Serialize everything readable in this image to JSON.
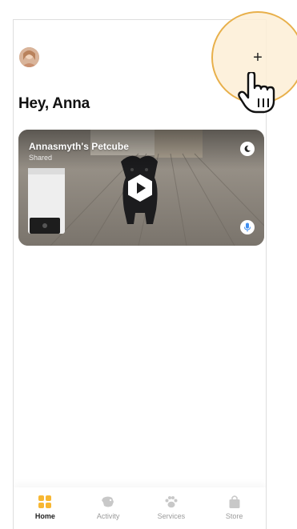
{
  "header": {
    "greeting": "Hey, Anna",
    "add_label": "+"
  },
  "camera_card": {
    "title": "Annasmyth's Petcube",
    "subtitle": "Shared"
  },
  "tabbar": {
    "tabs": [
      {
        "label": "Home",
        "icon": "home-grid-icon",
        "active": true
      },
      {
        "label": "Activity",
        "icon": "activity-icon",
        "active": false
      },
      {
        "label": "Services",
        "icon": "paw-icon",
        "active": false
      },
      {
        "label": "Store",
        "icon": "shopping-bag-icon",
        "active": false
      }
    ]
  },
  "colors": {
    "accent": "#f7b733",
    "highlight_ring": "#e8b04b",
    "highlight_fill": "#fdeed6",
    "mic_blue": "#3f8ef0"
  }
}
